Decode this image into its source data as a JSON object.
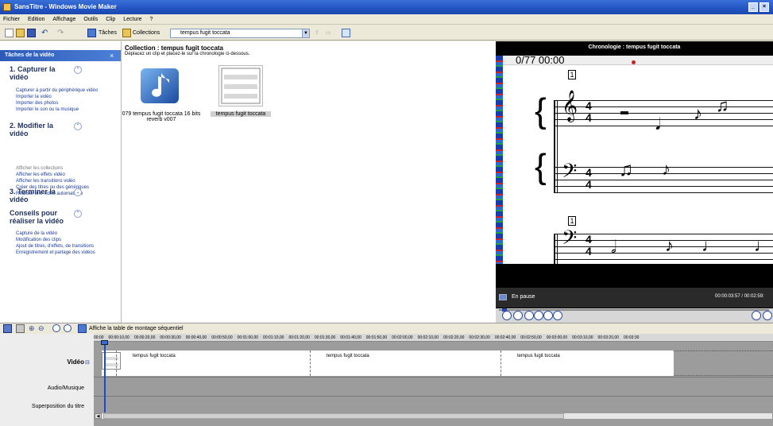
{
  "window": {
    "title": "SansTitre - Windows Movie Maker",
    "min": "_",
    "max": "□",
    "close": "×"
  },
  "menu": [
    "Fichier",
    "Edition",
    "Affichage",
    "Outils",
    "Clip",
    "Lecture",
    "?"
  ],
  "toolbar": {
    "tasks_label": "Tâches",
    "collections_label": "Collections",
    "combo_value": "tempus fugit toccata"
  },
  "tasks": {
    "header": "Tâches de la vidéo",
    "close": "×",
    "sections": [
      {
        "title": "1. Capturer la vidéo",
        "links": [
          "Capturer à partir du périphérique vidéo",
          "Importer la vidéo",
          "Importer des photos",
          "Importer le son ou la musique"
        ]
      },
      {
        "title": "2. Modifier la vidéo",
        "links": [
          "Afficher les collections",
          "Afficher les effets vidéo",
          "Afficher les transitions vidéo",
          "Créer des titres ou des génériques",
          "Réaliser une vidéo automatique"
        ]
      },
      {
        "title": "3. Terminer la vidéo",
        "links": []
      },
      {
        "title": "Conseils pour réaliser la vidéo",
        "links": [
          "Capture de la vidéo",
          "Modification des clips",
          "Ajout de titres, d'effets, de transitions",
          "Enregistrement et partage des vidéos"
        ]
      }
    ]
  },
  "collection": {
    "title": "Collection : tempus fugit toccata",
    "subtitle": "Déplacez un clip et placez-le sur la chronologie ci-dessous.",
    "clips": [
      {
        "label": "079 tempus fugit toccata 16 bits reverb v007",
        "icon": "music-note-icon"
      },
      {
        "label": "tempus fugit toccata",
        "icon": "score-thumbnail"
      }
    ]
  },
  "preview": {
    "title": "Chronologie : tempus fugit toccata",
    "time_overlay": "0/77 00:00",
    "status": "En pause",
    "time": "00:00:03:57 / 00:02:59:",
    "measure_1": "1",
    "measure_2": "1",
    "time_sig": "4"
  },
  "timeline": {
    "toolbar_label": "Affiche la table de montage séquentiel",
    "ruler": [
      "00:00",
      "00:00:10,00",
      "00:00:20,00",
      "00:00:30,00",
      "00:00:40,00",
      "00:00:50,00",
      "00:01:00,00",
      "00:01:10,00",
      "00:01:20,00",
      "00:01:30,00",
      "00:01:40,00",
      "00:01:50,00",
      "00:02:00,00",
      "00:02:10,00",
      "00:02:20,00",
      "00:02:30,00",
      "00:02:40,00",
      "00:02:50,00",
      "00:03:00,00",
      "00:03:10,00",
      "00:03:20,00",
      "00:03:30"
    ],
    "tracks": {
      "video": "Vidéo",
      "audio": "Audio/Musique",
      "overlay": "Superposition du titre",
      "expand": "⊟"
    },
    "segments": [
      "tempus fugit toccata",
      "tempus fugit toccata",
      "tempus fugit toccata"
    ]
  },
  "colors": {
    "accent": "#2254c2",
    "task_link": "#1a3a9a",
    "timeline_bg": "#9c9c9c"
  }
}
